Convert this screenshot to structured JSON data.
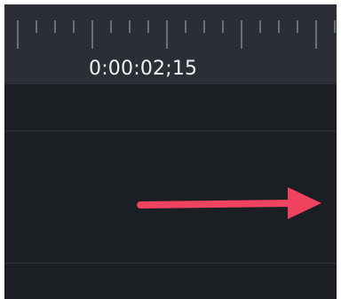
{
  "timeline": {
    "playhead_time": "0:00:02;15"
  },
  "annotation": {
    "type": "arrow",
    "direction": "right",
    "color": "#f0435f"
  },
  "colors": {
    "ruler_background": "#2b2f35",
    "track_background": "#1b1e22",
    "tick": "#6b7078",
    "timecode_text": "#eef0f2"
  }
}
